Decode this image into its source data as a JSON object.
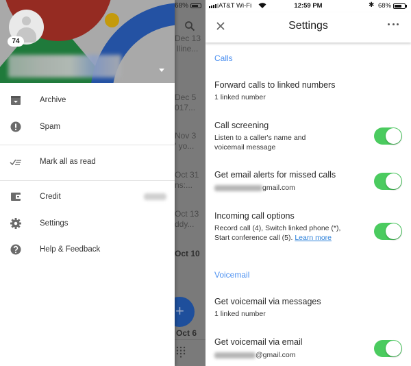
{
  "left": {
    "background_list": {
      "status_battery": "68%",
      "items": [
        {
          "date": "Dec 13",
          "snippet": "lline..."
        },
        {
          "date": "Dec 5",
          "snippet": "017..."
        },
        {
          "date": "Nov 3",
          "snippet": "' yo..."
        },
        {
          "date": "Oct 31",
          "snippet": "ns:..."
        },
        {
          "date": "Oct 13",
          "snippet": "ddy..."
        },
        {
          "date": "Oct 10",
          "snippet": ""
        },
        {
          "date": "Oct 6",
          "snippet": ""
        }
      ],
      "fab_label": "+"
    },
    "drawer": {
      "badge_count": "74",
      "menu": [
        {
          "icon": "archive-icon",
          "label": "Archive"
        },
        {
          "icon": "spam-icon",
          "label": "Spam"
        },
        {
          "icon": "mark-read-icon",
          "label": "Mark all as read"
        },
        {
          "icon": "credit-icon",
          "label": "Credit"
        },
        {
          "icon": "gear-icon",
          "label": "Settings"
        },
        {
          "icon": "help-icon",
          "label": "Help & Feedback"
        }
      ]
    }
  },
  "right": {
    "status_bar": {
      "carrier": "AT&T Wi-Fi",
      "time": "12:59 PM",
      "bluetooth": "✱",
      "battery": "68%"
    },
    "app_bar": {
      "title": "Settings",
      "close_icon": "close-icon",
      "more_icon": "more-horiz-icon"
    },
    "sections": [
      {
        "header": "Calls",
        "rows": [
          {
            "title": "Forward calls to linked numbers",
            "subtitle": "1 linked number",
            "toggle": null
          },
          {
            "title": "Call screening",
            "subtitle": "Listen to a caller's name and voicemail message",
            "toggle": true
          },
          {
            "title": "Get email alerts for missed calls",
            "subtitle_suffix": "gmail.com",
            "toggle": true
          },
          {
            "title": "Incoming call options",
            "subtitle": "Record call (4), Switch linked phone (*), Start conference call (5).",
            "link": "Learn more",
            "toggle": true
          }
        ]
      },
      {
        "header": "Voicemail",
        "rows": [
          {
            "title": "Get voicemail via messages",
            "subtitle": "1 linked number",
            "toggle": null
          },
          {
            "title": "Get voicemail via email",
            "subtitle_suffix": "@gmail.com",
            "toggle": true
          }
        ]
      }
    ],
    "colors": {
      "accent": "#4a8ff0",
      "toggle_on": "#4bcb5f",
      "link": "#2a7fd9"
    }
  }
}
